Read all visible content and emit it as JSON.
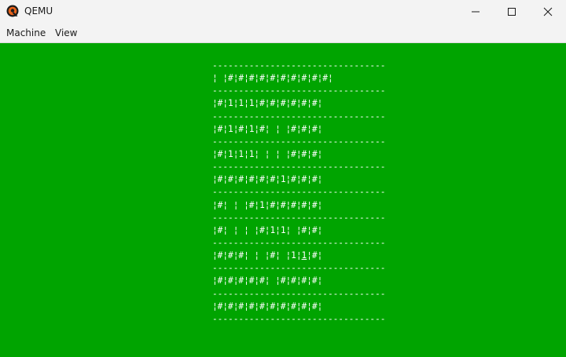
{
  "window": {
    "title": "QEMU",
    "icon": "qemu-logo-icon",
    "controls": [
      "minimize-icon",
      "maximize-icon",
      "close-icon"
    ]
  },
  "menu": {
    "machine": "Machine",
    "view": "View"
  },
  "screen": {
    "background_color": "#00a400",
    "text_color": "#ffffff",
    "lines": [
      "---------------------------------",
      "¦ ¦#¦#¦#¦#¦#¦#¦#¦#¦#¦#¦",
      "---------------------------------",
      "¦#¦1¦1¦1¦#¦#¦#¦#¦#¦#¦",
      "---------------------------------",
      "¦#¦1¦#¦1¦#¦ ¦ ¦#¦#¦#¦",
      "---------------------------------",
      "¦#¦1¦1¦1¦ ¦ ¦ ¦#¦#¦#¦",
      "---------------------------------",
      "¦#¦#¦#¦#¦#¦#¦1¦#¦#¦#¦",
      "---------------------------------",
      "¦#¦ ¦ ¦#¦1¦#¦#¦#¦#¦#¦",
      "---------------------------------",
      "¦#¦ ¦ ¦ ¦#¦1¦1¦ ¦#¦#¦",
      "---------------------------------",
      "¦#¦#¦#¦ ¦ ¦#¦ ¦1¦",
      "---------------------------------",
      "¦#¦#¦#¦#¦#¦ ¦#¦#¦#¦#¦",
      "---------------------------------",
      "¦#¦#¦#¦#¦#¦#¦#¦#¦#¦#¦",
      "---------------------------------"
    ],
    "cursor_row": {
      "before": "¦#¦#¦#¦ ¦ ¦#¦ ¦1¦",
      "cursor": "1",
      "after": "¦#¦"
    }
  }
}
